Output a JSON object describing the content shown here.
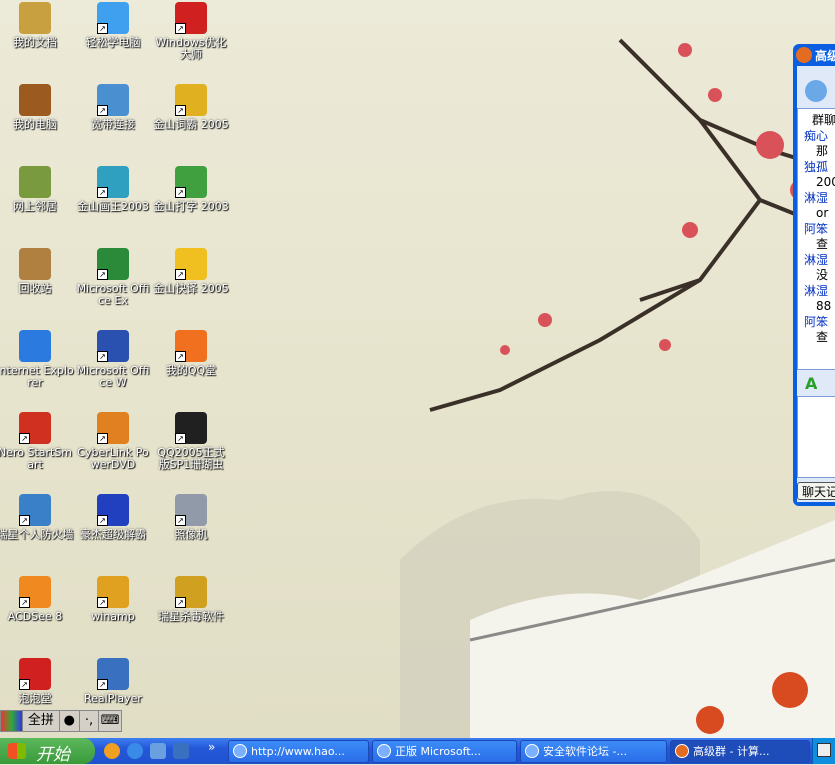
{
  "desktop": {
    "icons": [
      {
        "label": "我的文档",
        "color": "#c8a040",
        "shortcut": false
      },
      {
        "label": "我的电脑",
        "color": "#9a5a20",
        "shortcut": false
      },
      {
        "label": "网上邻居",
        "color": "#7a9a40",
        "shortcut": false
      },
      {
        "label": "回收站",
        "color": "#b08040",
        "shortcut": false
      },
      {
        "label": "Internet Explorer",
        "color": "#2a7ae0",
        "shortcut": false
      },
      {
        "label": "Nero StartSmart",
        "color": "#d03020",
        "shortcut": true
      },
      {
        "label": "瑞星个人防火墙",
        "color": "#3a80c8",
        "shortcut": true
      },
      {
        "label": "ACDSee 8",
        "color": "#f08a20",
        "shortcut": true
      },
      {
        "label": "泡泡堂",
        "color": "#d02020",
        "shortcut": true
      },
      {
        "label": "轻松学电脑",
        "color": "#40a0f0",
        "shortcut": true
      },
      {
        "label": "宽带连接",
        "color": "#4a90d0",
        "shortcut": true
      },
      {
        "label": "金山画王2003",
        "color": "#30a0c0",
        "shortcut": true
      },
      {
        "label": "Microsoft Office Ex",
        "color": "#2a8a3a",
        "shortcut": true
      },
      {
        "label": "Microsoft Office W",
        "color": "#2a50b0",
        "shortcut": true
      },
      {
        "label": "CyberLink PowerDVD",
        "color": "#e08020",
        "shortcut": true
      },
      {
        "label": "豪杰超级解霸",
        "color": "#2040c0",
        "shortcut": true
      },
      {
        "label": "winamp",
        "color": "#e0a020",
        "shortcut": true
      },
      {
        "label": "RealPlayer",
        "color": "#3a70c0",
        "shortcut": true
      },
      {
        "label": "Windows优化大师",
        "color": "#d02020",
        "shortcut": true
      },
      {
        "label": "金山词霸 2005",
        "color": "#e0b020",
        "shortcut": true
      },
      {
        "label": "金山打字 2003",
        "color": "#40a040",
        "shortcut": true
      },
      {
        "label": "金山快译 2005",
        "color": "#f0c020",
        "shortcut": true
      },
      {
        "label": "我的QQ堂",
        "color": "#f07020",
        "shortcut": true
      },
      {
        "label": "QQ2005正式版SP1珊瑚虫",
        "color": "#202020",
        "shortcut": true
      },
      {
        "label": "照像机",
        "color": "#909aa8",
        "shortcut": true
      },
      {
        "label": "瑞星杀毒软件",
        "color": "#d0a020",
        "shortcut": true
      }
    ]
  },
  "qq_window": {
    "title": "高级",
    "chat_header": "群聊",
    "lines": [
      {
        "t": "痴心",
        "c": "nm"
      },
      {
        "t": "那",
        "c": "ms"
      },
      {
        "t": "独孤",
        "c": "nm"
      },
      {
        "t": "200",
        "c": "ms"
      },
      {
        "t": "淋湿",
        "c": "nm"
      },
      {
        "t": "or",
        "c": "ms"
      },
      {
        "t": "阿笨",
        "c": "nm"
      },
      {
        "t": "查",
        "c": "ms"
      },
      {
        "t": "淋湿",
        "c": "nm"
      },
      {
        "t": "没",
        "c": "ms"
      },
      {
        "t": "淋湿",
        "c": "nm"
      },
      {
        "t": "88",
        "c": "ms"
      },
      {
        "t": "阿笨",
        "c": "nm"
      },
      {
        "t": "查",
        "c": "ms"
      }
    ],
    "format_icon": "A",
    "history_button": "聊天记"
  },
  "language_bar": {
    "mode": "全拼",
    "fullwidth": "●",
    "punct": "·,",
    "keyboard": "⌨"
  },
  "taskbar": {
    "start_label": "开始",
    "quick_launch": [
      "media-player-icon",
      "ie-icon",
      "outlook-icon",
      "firewall-icon"
    ],
    "overflow": "»",
    "tasks": [
      {
        "label": "http://www.hao..."
      },
      {
        "label": "正版 Microsoft..."
      },
      {
        "label": "安全软件论坛 -..."
      },
      {
        "label": "高级群 - 计算..."
      }
    ]
  }
}
